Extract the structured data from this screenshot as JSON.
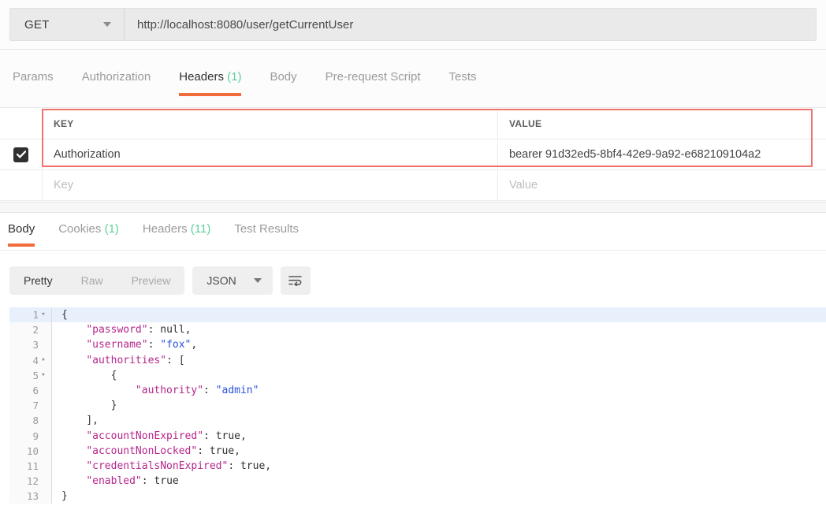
{
  "request": {
    "method": "GET",
    "method_icon": "chevron-down-icon",
    "url": "http://localhost:8080/user/getCurrentUser",
    "tabs": [
      {
        "label": "Params",
        "count": "",
        "active": false
      },
      {
        "label": "Authorization",
        "count": "",
        "active": false
      },
      {
        "label": "Headers",
        "count": "(1)",
        "active": true
      },
      {
        "label": "Body",
        "count": "",
        "active": false
      },
      {
        "label": "Pre-request Script",
        "count": "",
        "active": false
      },
      {
        "label": "Tests",
        "count": "",
        "active": false
      }
    ],
    "headers_table": {
      "columns": [
        "KEY",
        "VALUE"
      ],
      "rows": [
        {
          "checked": true,
          "key": "Authorization",
          "value": "bearer 91d32ed5-8bf4-42e9-9a92-e682109104a2"
        }
      ],
      "empty_row": {
        "key_placeholder": "Key",
        "value_placeholder": "Value"
      }
    },
    "annotation": {
      "type": "red-rectangle",
      "color": "#f0726f"
    }
  },
  "response": {
    "tabs": [
      {
        "label": "Body",
        "count": "",
        "active": true
      },
      {
        "label": "Cookies",
        "count": "(1)",
        "active": false
      },
      {
        "label": "Headers",
        "count": "(11)",
        "active": false
      },
      {
        "label": "Test Results",
        "count": "",
        "active": false
      }
    ],
    "toolbar": {
      "view_modes": [
        {
          "label": "Pretty",
          "active": true
        },
        {
          "label": "Raw",
          "active": false
        },
        {
          "label": "Preview",
          "active": false
        }
      ],
      "format": "JSON",
      "format_caret_icon": "chevron-down-icon",
      "wrap_button_icon": "word-wrap-icon"
    },
    "code": {
      "language": "json",
      "highlighted_line": 1,
      "lines": [
        {
          "n": "1",
          "fold": "▾",
          "indent": 1,
          "tokens": [
            {
              "t": "p",
              "v": "{"
            }
          ]
        },
        {
          "n": "2",
          "fold": "",
          "indent": 2,
          "tokens": [
            {
              "t": "k",
              "v": "\"password\""
            },
            {
              "t": "p",
              "v": ": "
            },
            {
              "t": "lit",
              "v": "null"
            },
            {
              "t": "p",
              "v": ","
            }
          ]
        },
        {
          "n": "3",
          "fold": "",
          "indent": 2,
          "tokens": [
            {
              "t": "k",
              "v": "\"username\""
            },
            {
              "t": "p",
              "v": ": "
            },
            {
              "t": "s",
              "v": "\"fox\""
            },
            {
              "t": "p",
              "v": ","
            }
          ]
        },
        {
          "n": "4",
          "fold": "▾",
          "indent": 2,
          "tokens": [
            {
              "t": "k",
              "v": "\"authorities\""
            },
            {
              "t": "p",
              "v": ": ["
            }
          ]
        },
        {
          "n": "5",
          "fold": "▾",
          "indent": 3,
          "tokens": [
            {
              "t": "p",
              "v": "{"
            }
          ]
        },
        {
          "n": "6",
          "fold": "",
          "indent": 4,
          "tokens": [
            {
              "t": "k",
              "v": "\"authority\""
            },
            {
              "t": "p",
              "v": ": "
            },
            {
              "t": "s",
              "v": "\"admin\""
            }
          ]
        },
        {
          "n": "7",
          "fold": "",
          "indent": 3,
          "tokens": [
            {
              "t": "p",
              "v": "}"
            }
          ]
        },
        {
          "n": "8",
          "fold": "",
          "indent": 2,
          "tokens": [
            {
              "t": "p",
              "v": "],"
            }
          ]
        },
        {
          "n": "9",
          "fold": "",
          "indent": 2,
          "tokens": [
            {
              "t": "k",
              "v": "\"accountNonExpired\""
            },
            {
              "t": "p",
              "v": ": "
            },
            {
              "t": "lit",
              "v": "true"
            },
            {
              "t": "p",
              "v": ","
            }
          ]
        },
        {
          "n": "10",
          "fold": "",
          "indent": 2,
          "tokens": [
            {
              "t": "k",
              "v": "\"accountNonLocked\""
            },
            {
              "t": "p",
              "v": ": "
            },
            {
              "t": "lit",
              "v": "true"
            },
            {
              "t": "p",
              "v": ","
            }
          ]
        },
        {
          "n": "11",
          "fold": "",
          "indent": 2,
          "tokens": [
            {
              "t": "k",
              "v": "\"credentialsNonExpired\""
            },
            {
              "t": "p",
              "v": ": "
            },
            {
              "t": "lit",
              "v": "true"
            },
            {
              "t": "p",
              "v": ","
            }
          ]
        },
        {
          "n": "12",
          "fold": "",
          "indent": 2,
          "tokens": [
            {
              "t": "k",
              "v": "\"enabled\""
            },
            {
              "t": "p",
              "v": ": "
            },
            {
              "t": "lit",
              "v": "true"
            }
          ]
        },
        {
          "n": "13",
          "fold": "",
          "indent": 1,
          "tokens": [
            {
              "t": "p",
              "v": "}"
            }
          ]
        }
      ]
    }
  },
  "colors": {
    "accent_orange": "#f26b3a",
    "count_green": "#5fcf9a",
    "annotation_red": "#f0726f",
    "json_key": "#b5268c",
    "json_string": "#2a51e0",
    "highlight_line": "#e8f0fb"
  }
}
